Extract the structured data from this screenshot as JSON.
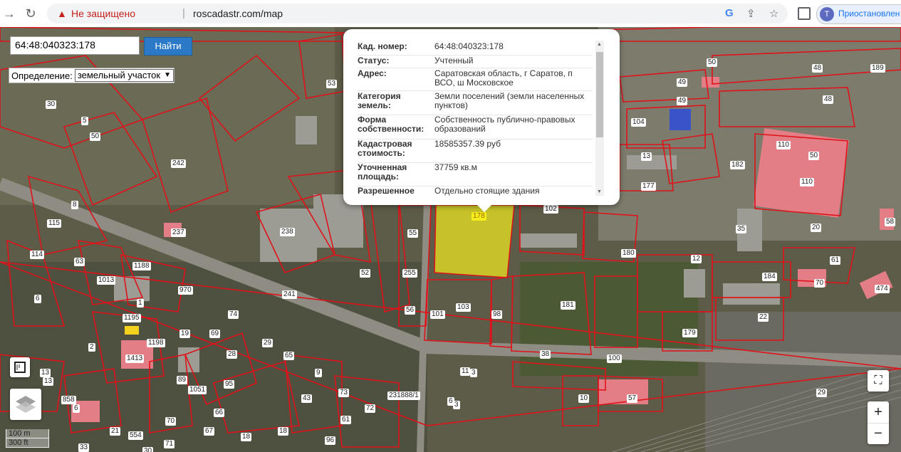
{
  "browser": {
    "security_label": "Не защищено",
    "url": "roscadastr.com/map",
    "profile_initial": "T",
    "profile_status": "Приостановлен"
  },
  "search": {
    "value": "64:48:040323:178",
    "button": "Найти",
    "definition_label": "Определение:",
    "definition_value": "земельный участок"
  },
  "popup": {
    "rows": [
      {
        "k": "Кад. номер:",
        "v": "64:48:040323:178"
      },
      {
        "k": "Статус:",
        "v": "Учтенный"
      },
      {
        "k": "Адрес:",
        "v": "Саратовская область, г Саратов, п ВСО, ш Московское"
      },
      {
        "k": "Категория земель:",
        "v": "Земли поселений (земли населенных пунктов)"
      },
      {
        "k": "Форма собственности:",
        "v": "Собственность публично-правовых образований"
      },
      {
        "k": "Кадастровая стоимость:",
        "v": "18585357.39 руб"
      },
      {
        "k": "Уточненная площадь:",
        "v": "37759 кв.м"
      },
      {
        "k": "Разрешенное",
        "v": "Отдельно стоящие здания"
      }
    ]
  },
  "map": {
    "highlight_color": "#f5ee1c",
    "boundary_color": "#e0121a",
    "parcel_labels": [
      "178",
      "102",
      "55",
      "255",
      "56",
      "101",
      "103",
      "98",
      "181",
      "180",
      "12",
      "184",
      "61",
      "70",
      "474",
      "58",
      "20",
      "35",
      "110",
      "110",
      "50",
      "182",
      "13",
      "177",
      "104",
      "49",
      "49",
      "50",
      "48",
      "48",
      "189",
      "53",
      "30",
      "5",
      "50",
      "242",
      "238",
      "8",
      "115",
      "237",
      "114",
      "63",
      "1188",
      "1013",
      "970",
      "1",
      "6",
      "1195",
      "1198",
      "1413",
      "2",
      "19",
      "69",
      "74",
      "28",
      "29",
      "65",
      "9",
      "95",
      "1051",
      "89",
      "13",
      "858",
      "6",
      "21",
      "554",
      "70",
      "66",
      "67",
      "43",
      "73",
      "61",
      "72",
      "96",
      "18",
      "18",
      "33",
      "30",
      "71",
      "231888/1",
      "6",
      "11",
      "3",
      "38",
      "100",
      "10",
      "57",
      "22",
      "179",
      "29",
      "52",
      "241",
      "3",
      "13"
    ],
    "scale_metric": "100 m",
    "scale_imperial": "300 ft",
    "zoom_in": "+",
    "zoom_out": "−"
  }
}
